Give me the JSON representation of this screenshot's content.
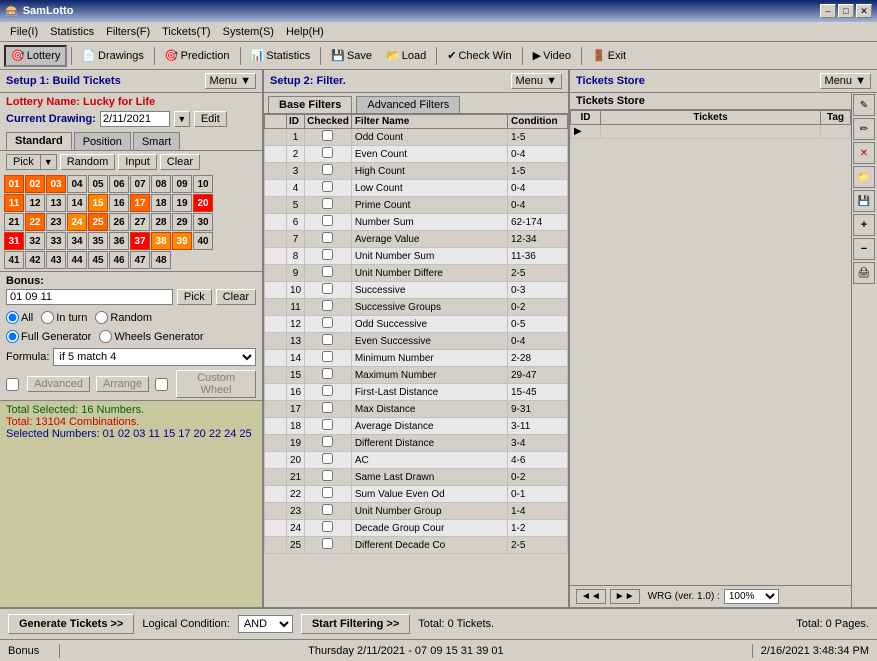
{
  "titlebar": {
    "title": "SamLotto",
    "min": "–",
    "max": "□",
    "close": "✕"
  },
  "menubar": {
    "items": [
      "File(I)",
      "Statistics",
      "Filters(F)",
      "Tickets(T)",
      "System(S)",
      "Help(H)"
    ]
  },
  "toolbar": {
    "items": [
      {
        "label": "Lottery",
        "icon": "🎰"
      },
      {
        "label": "Drawings",
        "icon": "📄"
      },
      {
        "label": "Prediction",
        "icon": "🎯"
      },
      {
        "label": "Statistics",
        "icon": "📊"
      },
      {
        "label": "Save",
        "icon": "💾"
      },
      {
        "label": "Load",
        "icon": "📂"
      },
      {
        "label": "Check Win",
        "icon": "✔"
      },
      {
        "label": "Video",
        "icon": "▶"
      },
      {
        "label": "Exit",
        "icon": "🚪"
      }
    ]
  },
  "left_panel": {
    "header": "Setup 1: Build  Tickets",
    "menu_btn": "Menu ▼",
    "lottery_name_label": "Lottery  Name:",
    "lottery_name": "Lucky for Life",
    "drawing_label": "Current Drawing:",
    "drawing_value": "2/11/2021",
    "edit_btn": "Edit",
    "tabs": [
      "Standard",
      "Position",
      "Smart"
    ],
    "active_tab": "Standard",
    "controls": {
      "pick_label": "Pick",
      "random_label": "Random",
      "input_label": "Input",
      "clear_label": "Clear"
    },
    "numbers": [
      [
        1,
        2,
        3,
        4,
        5,
        6,
        7,
        8,
        9,
        10
      ],
      [
        11,
        12,
        13,
        14,
        15,
        16,
        17,
        18,
        19,
        20
      ],
      [
        21,
        22,
        23,
        24,
        25,
        26,
        27,
        28,
        29,
        30
      ],
      [
        31,
        32,
        33,
        34,
        35,
        36,
        37,
        38,
        39,
        40
      ],
      [
        41,
        42,
        43,
        44,
        45,
        46,
        47,
        48
      ]
    ],
    "selected_numbers": [
      1,
      2,
      3,
      11,
      15,
      17,
      20,
      22,
      24,
      25,
      38,
      39
    ],
    "bonus_label": "Bonus:",
    "bonus_value": "01 09 11",
    "bonus_pick": "Pick",
    "bonus_clear": "Clear",
    "radio_groups": {
      "order": [
        "All",
        "In turn",
        "Random"
      ],
      "generator": [
        "Full Generator",
        "Wheels Generator"
      ]
    },
    "formula_label": "Formula:",
    "formula_value": "if 5 match 4",
    "advanced_label": "Advanced",
    "arrange_label": "Arrange",
    "custom_wheel_label": "Custom Wheel",
    "status_lines": [
      "Total Selected: 16 Numbers.",
      "Total: 13104 Combinations.",
      "Selected Numbers: 01 02 03 11 15 17 20 22 24 25"
    ]
  },
  "middle_panel": {
    "header": "Setup 2: Filter.",
    "menu_btn": "Menu ▼",
    "tabs": [
      "Base Filters",
      "Advanced Filters"
    ],
    "active_tab": "Base Filters",
    "table_headers": [
      "ID",
      "Checked",
      "Filter Name",
      "Condition"
    ],
    "filters": [
      {
        "id": 1,
        "name": "Odd Count",
        "condition": "1-5",
        "checked": false
      },
      {
        "id": 2,
        "name": "Even Count",
        "condition": "0-4",
        "checked": false
      },
      {
        "id": 3,
        "name": "High Count",
        "condition": "1-5",
        "checked": false
      },
      {
        "id": 4,
        "name": "Low Count",
        "condition": "0-4",
        "checked": false
      },
      {
        "id": 5,
        "name": "Prime Count",
        "condition": "0-4",
        "checked": false
      },
      {
        "id": 6,
        "name": "Number Sum",
        "condition": "62-174",
        "checked": false
      },
      {
        "id": 7,
        "name": "Average Value",
        "condition": "12-34",
        "checked": false
      },
      {
        "id": 8,
        "name": "Unit Number Sum",
        "condition": "11-36",
        "checked": false
      },
      {
        "id": 9,
        "name": "Unit Number Differe",
        "condition": "2-5",
        "checked": false
      },
      {
        "id": 10,
        "name": "Successive",
        "condition": "0-3",
        "checked": false
      },
      {
        "id": 11,
        "name": "Successive Groups",
        "condition": "0-2",
        "checked": false
      },
      {
        "id": 12,
        "name": "Odd Successive",
        "condition": "0-5",
        "checked": false
      },
      {
        "id": 13,
        "name": "Even Successive",
        "condition": "0-4",
        "checked": false
      },
      {
        "id": 14,
        "name": "Minimum Number",
        "condition": "2-28",
        "checked": false
      },
      {
        "id": 15,
        "name": "Maximum Number",
        "condition": "29-47",
        "checked": false
      },
      {
        "id": 16,
        "name": "First-Last Distance",
        "condition": "15-45",
        "checked": false
      },
      {
        "id": 17,
        "name": "Max Distance",
        "condition": "9-31",
        "checked": false
      },
      {
        "id": 18,
        "name": "Average Distance",
        "condition": "3-11",
        "checked": false
      },
      {
        "id": 19,
        "name": "Different Distance",
        "condition": "3-4",
        "checked": false
      },
      {
        "id": 20,
        "name": "AC",
        "condition": "4-6",
        "checked": false
      },
      {
        "id": 21,
        "name": "Same Last Drawn",
        "condition": "0-2",
        "checked": false
      },
      {
        "id": 22,
        "name": "Sum Value Even Od",
        "condition": "0-1",
        "checked": false
      },
      {
        "id": 23,
        "name": "Unit Number Group",
        "condition": "1-4",
        "checked": false
      },
      {
        "id": 24,
        "name": "Decade Group Cour",
        "condition": "1-2",
        "checked": false
      },
      {
        "id": 25,
        "name": "Different Decade Co",
        "condition": "2-5",
        "checked": false
      }
    ]
  },
  "right_panel": {
    "header": "Tickets Store",
    "menu_btn": "Menu ▼",
    "subtitle": "Tickets Store",
    "table_headers": [
      "ID",
      "Tickets",
      "Tag"
    ],
    "nav": {
      "back_btn": "◄◄",
      "forward_btn": "►►",
      "version": "WRG (ver. 1.0) :",
      "zoom": "100%"
    },
    "toolbar_buttons": [
      "✎",
      "✎",
      "✕",
      "📁",
      "💾",
      "➕",
      "➖",
      "🖨"
    ]
  },
  "bottom_bar": {
    "gen_btn": "Generate Tickets >>",
    "logical_label": "Logical Condition:",
    "logical_value": "AND",
    "filter_btn": "Start Filtering >>",
    "total_tickets": "Total: 0 Tickets.",
    "total_pages": "Total: 0 Pages."
  },
  "status_bar": {
    "left": "Bonus",
    "center": "Thursday 2/11/2021 - 07 09 15 31 39 01",
    "right": "2/16/2021  3:48:34 PM"
  }
}
